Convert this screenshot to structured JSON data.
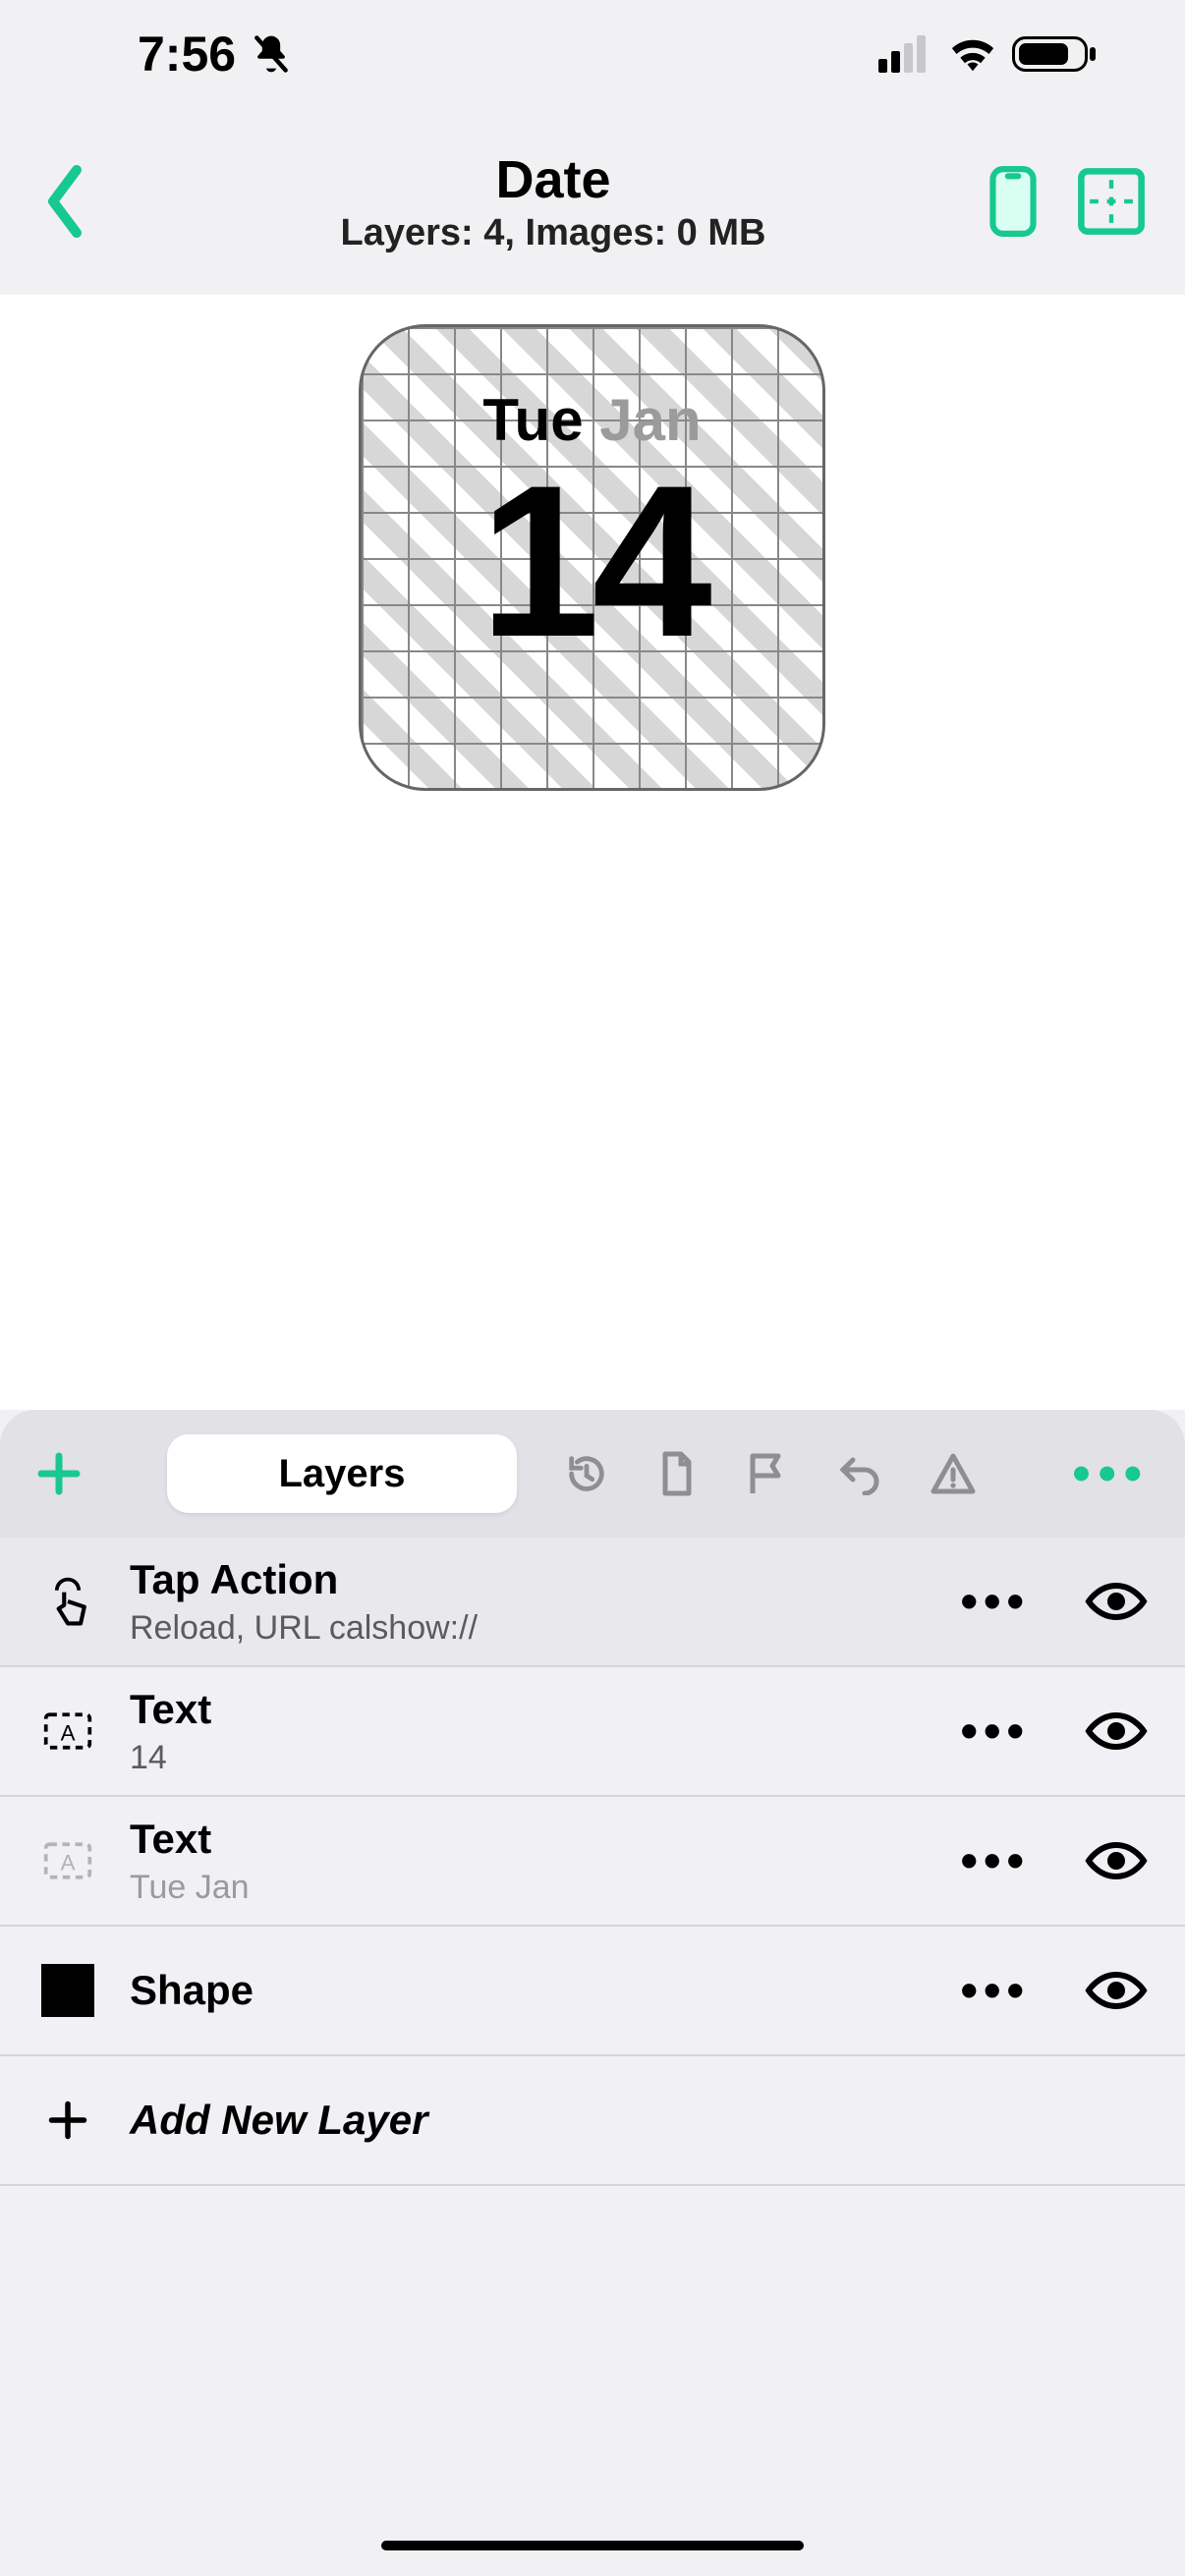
{
  "status": {
    "time": "7:56"
  },
  "header": {
    "title": "Date",
    "subtitle": "Layers: 4, Images: 0 MB"
  },
  "widget": {
    "line1_a": "Tue",
    "line1_b": " Jan",
    "number": "14"
  },
  "toolbar": {
    "tab_label": "Layers"
  },
  "layers": [
    {
      "title": "Tap Action",
      "sub": "Reload, URL calshow://",
      "selected": true,
      "type": "tap",
      "dim": false
    },
    {
      "title": "Text",
      "sub": "14",
      "selected": false,
      "type": "text",
      "dim": false
    },
    {
      "title": "Text",
      "sub": "Tue Jan",
      "selected": false,
      "type": "text",
      "dim": true
    },
    {
      "title": "Shape",
      "sub": "",
      "selected": false,
      "type": "shape",
      "dim": false
    }
  ],
  "add_layer_label": "Add New Layer"
}
